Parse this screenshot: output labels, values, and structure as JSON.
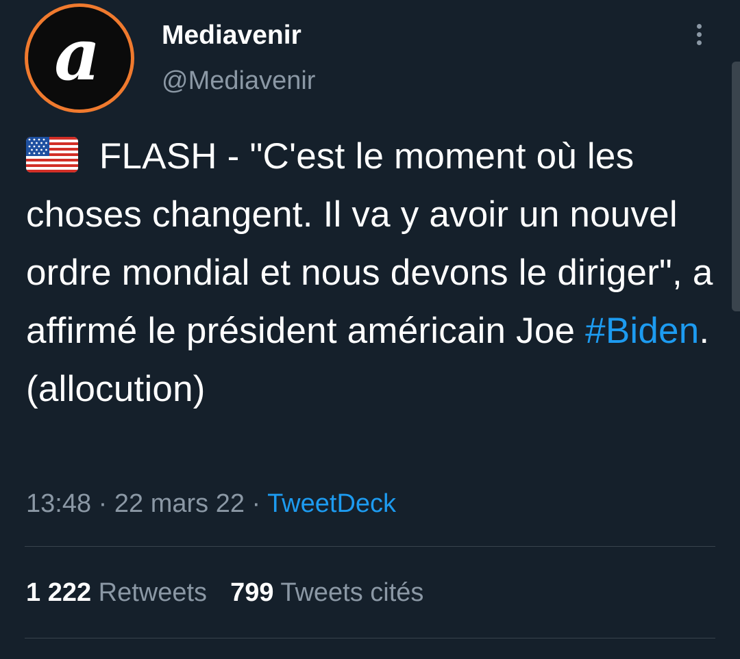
{
  "account": {
    "display_name": "Mediavenir",
    "handle": "@Mediavenir",
    "avatar_letter": "a",
    "avatar_ring_color": "#f07a2e"
  },
  "menu": {
    "icon": "more-vertical-icon"
  },
  "tweet": {
    "flag_icon": "us-flag-icon",
    "text_before": " FLASH - \"C'est le moment où les choses changent. Il va y avoir un nouvel ordre mondial et nous devons le diriger\", a affirmé le président américain Joe ",
    "hashtag": "#Biden",
    "text_after": ". (allocution)"
  },
  "meta": {
    "time": "13:48",
    "separator": " · ",
    "date": "22 mars 22",
    "source": "TweetDeck"
  },
  "stats": {
    "retweets_count": "1 222",
    "retweets_label": "Retweets",
    "quotes_count": "799",
    "quotes_label": "Tweets cités"
  },
  "colors": {
    "background": "#15202b",
    "text": "#ffffff",
    "secondary_text": "#8b98a5",
    "link": "#1d9bf0",
    "divider": "#38444d"
  }
}
